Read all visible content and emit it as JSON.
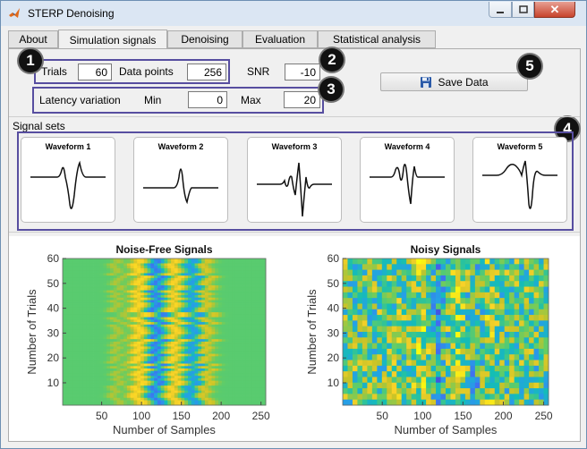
{
  "window": {
    "title": "STERP Denoising",
    "close_glyph": "✕"
  },
  "tabs": [
    {
      "label": "About"
    },
    {
      "label": "Simulation signals"
    },
    {
      "label": "Denoising"
    },
    {
      "label": "Evaluation"
    },
    {
      "label": "Statistical analysis"
    }
  ],
  "params": {
    "trials_label": "Trials",
    "trials_value": "60",
    "datapoints_label": "Data points",
    "datapoints_value": "256",
    "snr_label": "SNR",
    "snr_value": "-10",
    "latency_label": "Latency variation",
    "min_label": "Min",
    "min_value": "0",
    "max_label": "Max",
    "max_value": "20"
  },
  "save_button": {
    "label": "Save Data",
    "icon": "floppy-disk-icon"
  },
  "signal_sets": {
    "label": "Signal sets",
    "waveforms": [
      {
        "label": "Waveform 1"
      },
      {
        "label": "Waveform 2"
      },
      {
        "label": "Waveform 3"
      },
      {
        "label": "Waveform 4"
      },
      {
        "label": "Waveform 5"
      }
    ]
  },
  "badges": [
    "1",
    "2",
    "3",
    "4",
    "5"
  ],
  "colors": {
    "highlight": "#574ea0",
    "tab_active_bg": "#f0f0f0",
    "close_button": "#c7432c"
  },
  "chart_data": [
    {
      "type": "heatmap",
      "title": "Noise-Free Signals",
      "xlabel": "Number of Samples",
      "ylabel": "Number of Trials",
      "xlim": [
        1,
        256
      ],
      "ylim": [
        1,
        60
      ],
      "xticks": [
        50,
        100,
        150,
        200,
        250
      ],
      "yticks": [
        10,
        20,
        30,
        40,
        50,
        60
      ],
      "colormap": "parula"
    },
    {
      "type": "heatmap",
      "title": "Noisy Signals",
      "xlabel": "Number of Samples",
      "ylabel": "Number of Trials",
      "xlim": [
        1,
        256
      ],
      "ylim": [
        1,
        60
      ],
      "xticks": [
        50,
        100,
        150,
        200,
        250
      ],
      "yticks": [
        10,
        20,
        30,
        40,
        50,
        60
      ],
      "colormap": "parula"
    }
  ]
}
